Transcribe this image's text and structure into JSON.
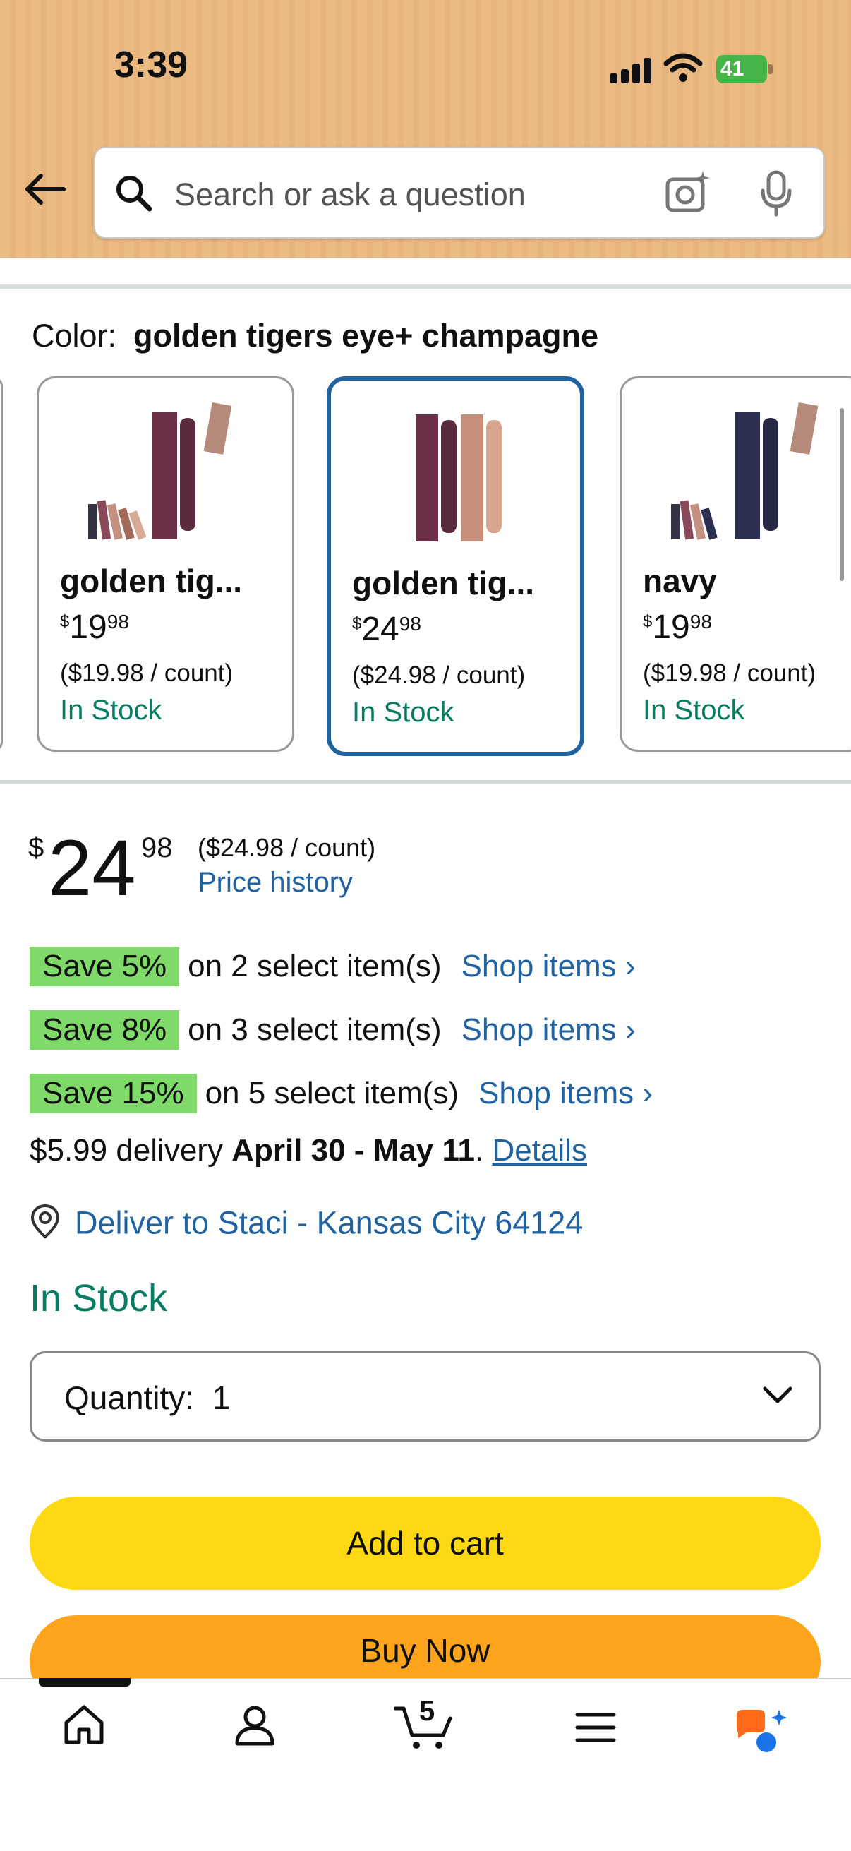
{
  "status_bar": {
    "time": "3:39",
    "battery": "41"
  },
  "search": {
    "placeholder": "Search or ask a question"
  },
  "color": {
    "label": "Color:",
    "selected": "golden tigers eye+ champagne",
    "options": [
      {
        "name": "golden tig...",
        "price_whole": "19",
        "price_cents": "98",
        "currency": "$",
        "unit_price": "($19.98 / count)",
        "stock": "In Stock",
        "selected": false
      },
      {
        "name": "golden tig...",
        "price_whole": "24",
        "price_cents": "98",
        "currency": "$",
        "unit_price": "($24.98 / count)",
        "stock": "In Stock",
        "selected": true
      },
      {
        "name": "navy",
        "price_whole": "19",
        "price_cents": "98",
        "currency": "$",
        "unit_price": "($19.98 / count)",
        "stock": "In Stock",
        "selected": false
      }
    ]
  },
  "price": {
    "currency": "$",
    "whole": "24",
    "cents": "98",
    "per_count": "($24.98 / count)",
    "history_link": "Price history"
  },
  "promos": [
    {
      "badge": "Save 5%",
      "desc": "on 2 select item(s)",
      "link": "Shop items ›"
    },
    {
      "badge": "Save 8%",
      "desc": "on 3 select item(s)",
      "link": "Shop items ›"
    },
    {
      "badge": "Save 15%",
      "desc": "on 5 select item(s)",
      "link": "Shop items ›"
    }
  ],
  "delivery": {
    "prefix": "$5.99 delivery ",
    "dates": "April 30 - May 11",
    "suffix": ". ",
    "details_link": "Details"
  },
  "deliver_to": "Deliver to Staci - Kansas City 64124",
  "availability": "In Stock",
  "quantity": {
    "label": "Quantity:",
    "value": "1"
  },
  "buttons": {
    "add_to_cart": "Add to cart",
    "buy_now": "Buy Now"
  },
  "nav": {
    "cart_count": "5"
  },
  "colors": {
    "link": "#2162a1",
    "in_stock": "#067d62",
    "save_badge": "#7fda69",
    "add_to_cart": "#ffd814",
    "buy_now": "#ffa41c"
  }
}
